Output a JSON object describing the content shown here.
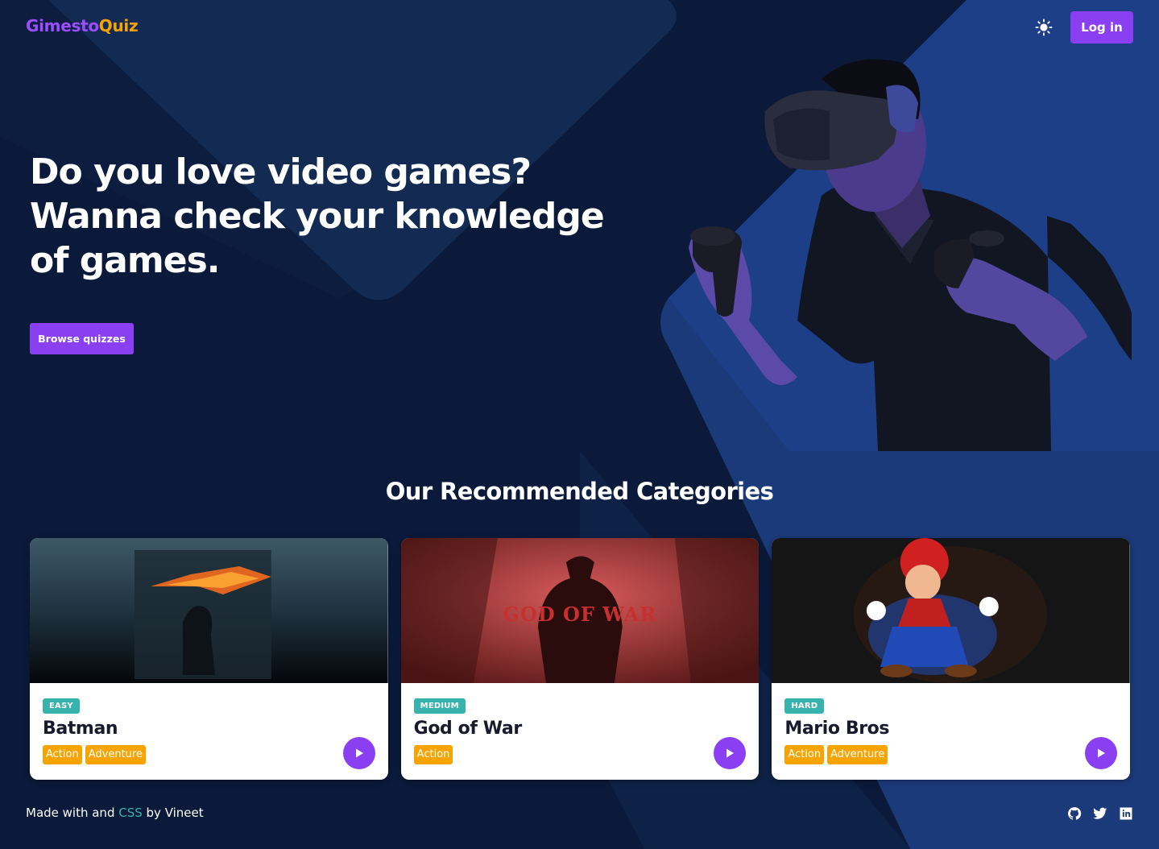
{
  "header": {
    "logo_part1": "Gimesto",
    "logo_part2": "Quiz",
    "theme_icon": "sun-icon",
    "login_label": "Log in"
  },
  "hero": {
    "title_lines": [
      "Do you love video games?",
      "Wanna check your knowledge",
      "of games."
    ],
    "browse_label": "Browse quizzes"
  },
  "section": {
    "title": "Our Recommended Categories"
  },
  "cards": [
    {
      "difficulty": "EASY",
      "title": "Batman",
      "tags": [
        "Action",
        "Adventure"
      ]
    },
    {
      "difficulty": "MEDIUM",
      "title": "God of War",
      "tags": [
        "Action"
      ]
    },
    {
      "difficulty": "HARD",
      "title": "Mario Bros",
      "tags": [
        "Action",
        "Adventure"
      ]
    }
  ],
  "footer": {
    "text_before": "Made with and ",
    "css_word": "CSS",
    "text_after": " by Vineet",
    "social_icons": [
      "github-icon",
      "twitter-icon",
      "linkedin-icon"
    ]
  },
  "colors": {
    "background": "#0b1a3a",
    "accent_purple": "#8b3ff3",
    "accent_orange": "#f7a400",
    "teal": "#38b2ac"
  }
}
